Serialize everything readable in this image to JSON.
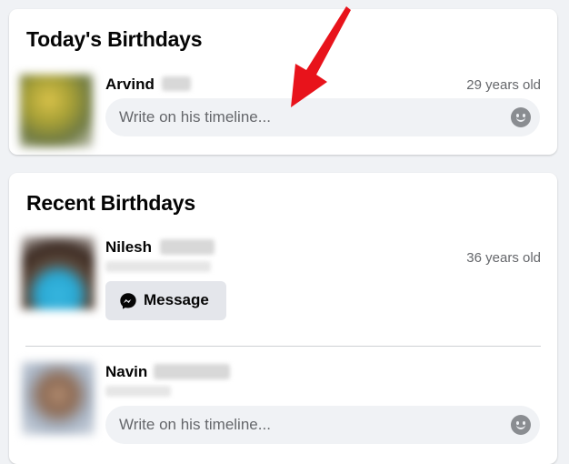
{
  "today": {
    "title": "Today's Birthdays",
    "people": [
      {
        "first_name": "Arvind",
        "age": "29 years old",
        "composer_placeholder": "Write on his timeline..."
      }
    ]
  },
  "recent": {
    "title": "Recent Birthdays",
    "people": [
      {
        "first_name": "Nilesh",
        "age": "36 years old",
        "action_label": "Message"
      },
      {
        "first_name": "Navin",
        "composer_placeholder": "Write on his timeline..."
      }
    ]
  },
  "icons": {
    "messenger": "messenger-icon",
    "emoji": "emoji-icon",
    "annotation": "red-arrow"
  },
  "colors": {
    "page_bg": "#f0f2f5",
    "card_bg": "#ffffff",
    "input_bg": "#f0f2f5",
    "button_bg": "#e4e6eb",
    "secondary_text": "#65676b",
    "annotation_arrow": "#e8131b"
  }
}
